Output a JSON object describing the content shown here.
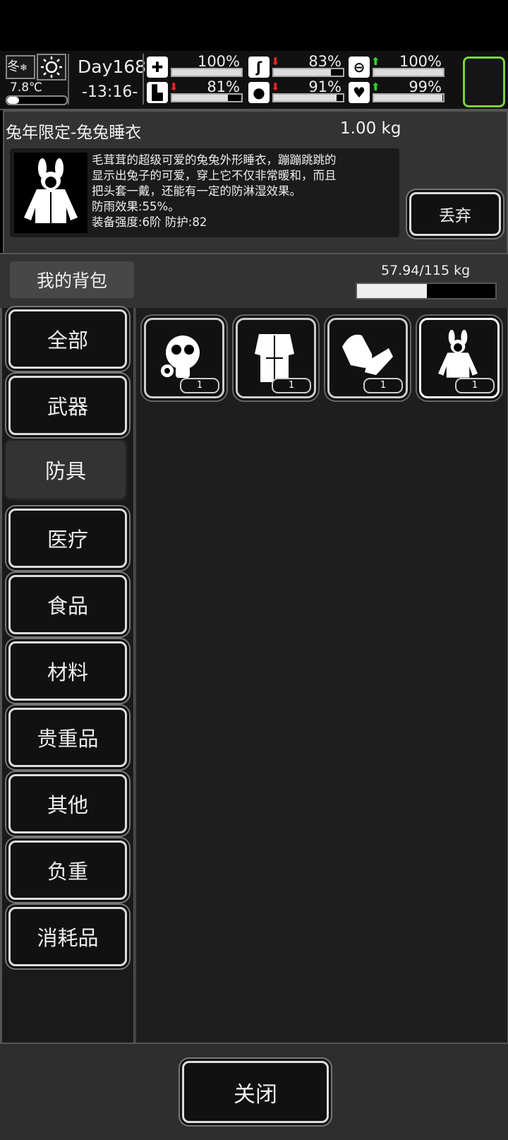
{
  "hud": {
    "season": "冬",
    "weather_icon": "sun-icon",
    "temperature": "7.8℃",
    "temperature_level": 0.2,
    "day": "Day168",
    "time": "-13:16-",
    "stats": [
      {
        "name": "health",
        "icon": "medkit-icon",
        "value": "100%",
        "level": 1.0,
        "trend": ""
      },
      {
        "name": "hunger",
        "icon": "stomach-icon",
        "value": "83%",
        "level": 0.83,
        "trend": "down"
      },
      {
        "name": "mood",
        "icon": "pill-icon",
        "value": "100%",
        "level": 1.0,
        "trend": "up"
      },
      {
        "name": "stamina",
        "icon": "foot-icon",
        "value": "81%",
        "level": 0.81,
        "trend": "down"
      },
      {
        "name": "thirst",
        "icon": "water-drop-icon",
        "value": "91%",
        "level": 0.91,
        "trend": "down"
      },
      {
        "name": "sanity",
        "icon": "heart-icon",
        "value": "99%",
        "level": 0.99,
        "trend": "up"
      }
    ]
  },
  "item": {
    "name": "兔年限定-兔兔睡衣",
    "weight": "1.00 kg",
    "desc_lines": [
      "毛茸茸的超级可爱的兔兔外形睡衣，蹦蹦跳跳的",
      "显示出兔子的可爱，穿上它不仅非常暖和，而且",
      "把头套一戴，还能有一定的防淋湿效果。",
      "防雨效果:55%。",
      "装备强度:6阶  防护:82"
    ],
    "drop_label": "丢弃"
  },
  "bag": {
    "title": "我的背包",
    "capacity": "57.94/115 kg",
    "fill_level": 0.5038
  },
  "categories": [
    "全部",
    "武器",
    "防具",
    "医疗",
    "食品",
    "材料",
    "贵重品",
    "其他",
    "负重",
    "消耗品"
  ],
  "active_category": "防具",
  "items": [
    {
      "icon": "gas-mask-icon",
      "count": "1"
    },
    {
      "icon": "fur-coat-icon",
      "count": "1"
    },
    {
      "icon": "gloves-icon",
      "count": "1"
    },
    {
      "icon": "bunny-pajamas-icon",
      "count": "1"
    }
  ],
  "footer": {
    "close_label": "关闭"
  }
}
